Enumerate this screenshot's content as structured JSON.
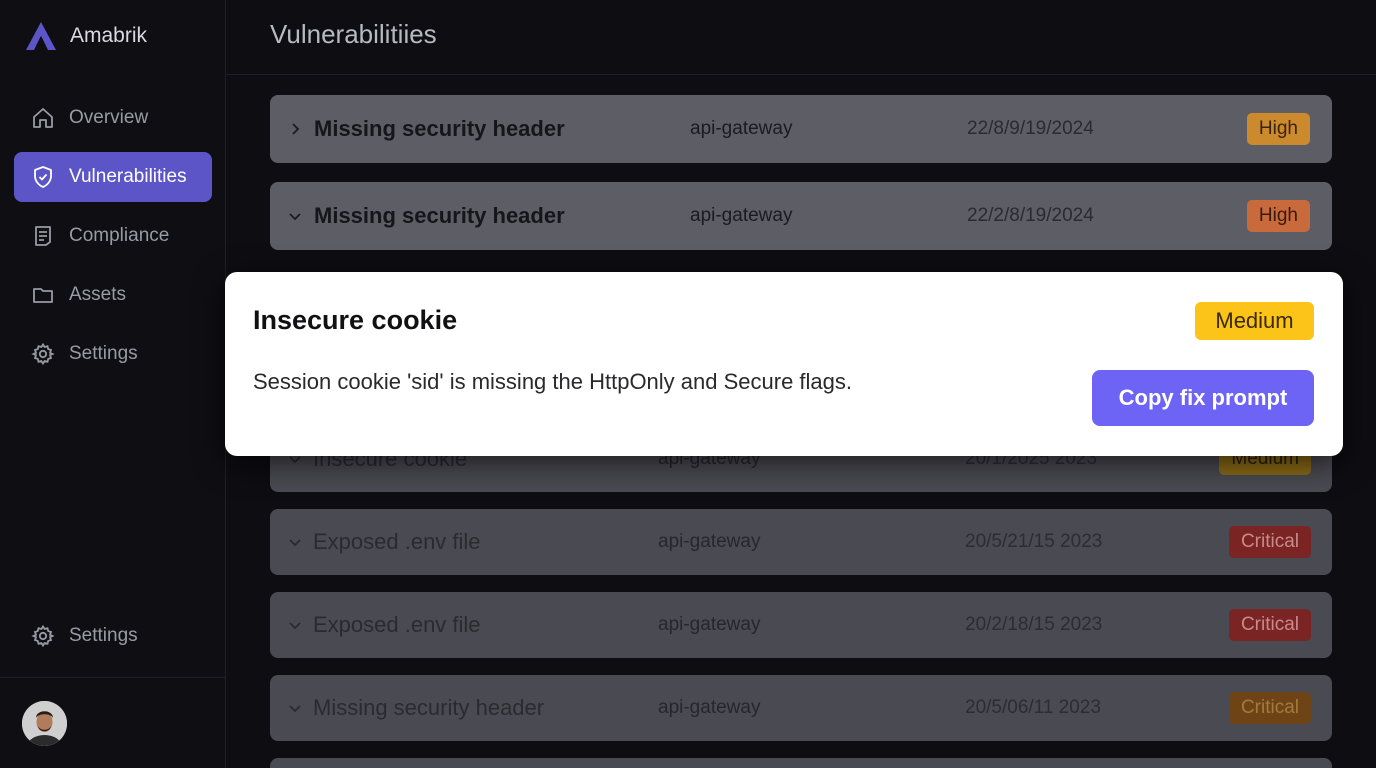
{
  "brand": {
    "name": "Amabrik",
    "logo_color": "#5b55c7"
  },
  "sidebar": {
    "items": [
      {
        "label": "Overview",
        "icon": "home-icon"
      },
      {
        "label": "Vulnerabilities",
        "icon": "shield-icon",
        "active": true
      },
      {
        "label": "Compliance",
        "icon": "document-icon"
      },
      {
        "label": "Assets",
        "icon": "folder-icon"
      },
      {
        "label": "Settings",
        "icon": "gear-icon"
      }
    ],
    "bottom_item": {
      "label": "Settings",
      "icon": "gear-icon"
    }
  },
  "header": {
    "title": "Vulnerabilitiies"
  },
  "rows": [
    {
      "title": "Missing security header",
      "asset": "api-gateway",
      "date": "22/8/9/19/2024",
      "severity": "High",
      "chevron": "chevron-right-icon"
    },
    {
      "title": "Missing security header",
      "asset": "api-gateway",
      "date": "22/2/8/19/2024",
      "severity": "High",
      "chevron": "chevron-down-icon"
    },
    {
      "title": "Insecure cookie",
      "asset": "api-gateway",
      "date": "20/1/2025 2023",
      "severity": "Medium",
      "chevron": "chevron-down-icon"
    },
    {
      "title": "Exposed .env file",
      "asset": "api-gateway",
      "date": "20/5/21/15 2023",
      "severity": "Critical",
      "chevron": "chevron-down-icon"
    },
    {
      "title": "Exposed .env file",
      "asset": "api-gateway",
      "date": "20/2/18/15 2023",
      "severity": "Critical",
      "chevron": "chevron-down-icon"
    },
    {
      "title": "Missing security header",
      "asset": "api-gateway",
      "date": "20/5/06/11 2023",
      "severity": "Critical",
      "chevron": "chevron-down-icon"
    }
  ],
  "severity_colors": {
    "High": "#cc8a2e",
    "High2": "#c96a3c",
    "Medium": "#b08a1e",
    "Critical": "#8a2a2a",
    "Critical2": "#6e4416"
  },
  "modal": {
    "title": "Insecure cookie",
    "severity": "Medium",
    "description": "Session cookie 'sid' is missing the HttpOnly and Secure flags.",
    "action_label": "Copy fix prompt",
    "accent": "#6d64f5"
  }
}
